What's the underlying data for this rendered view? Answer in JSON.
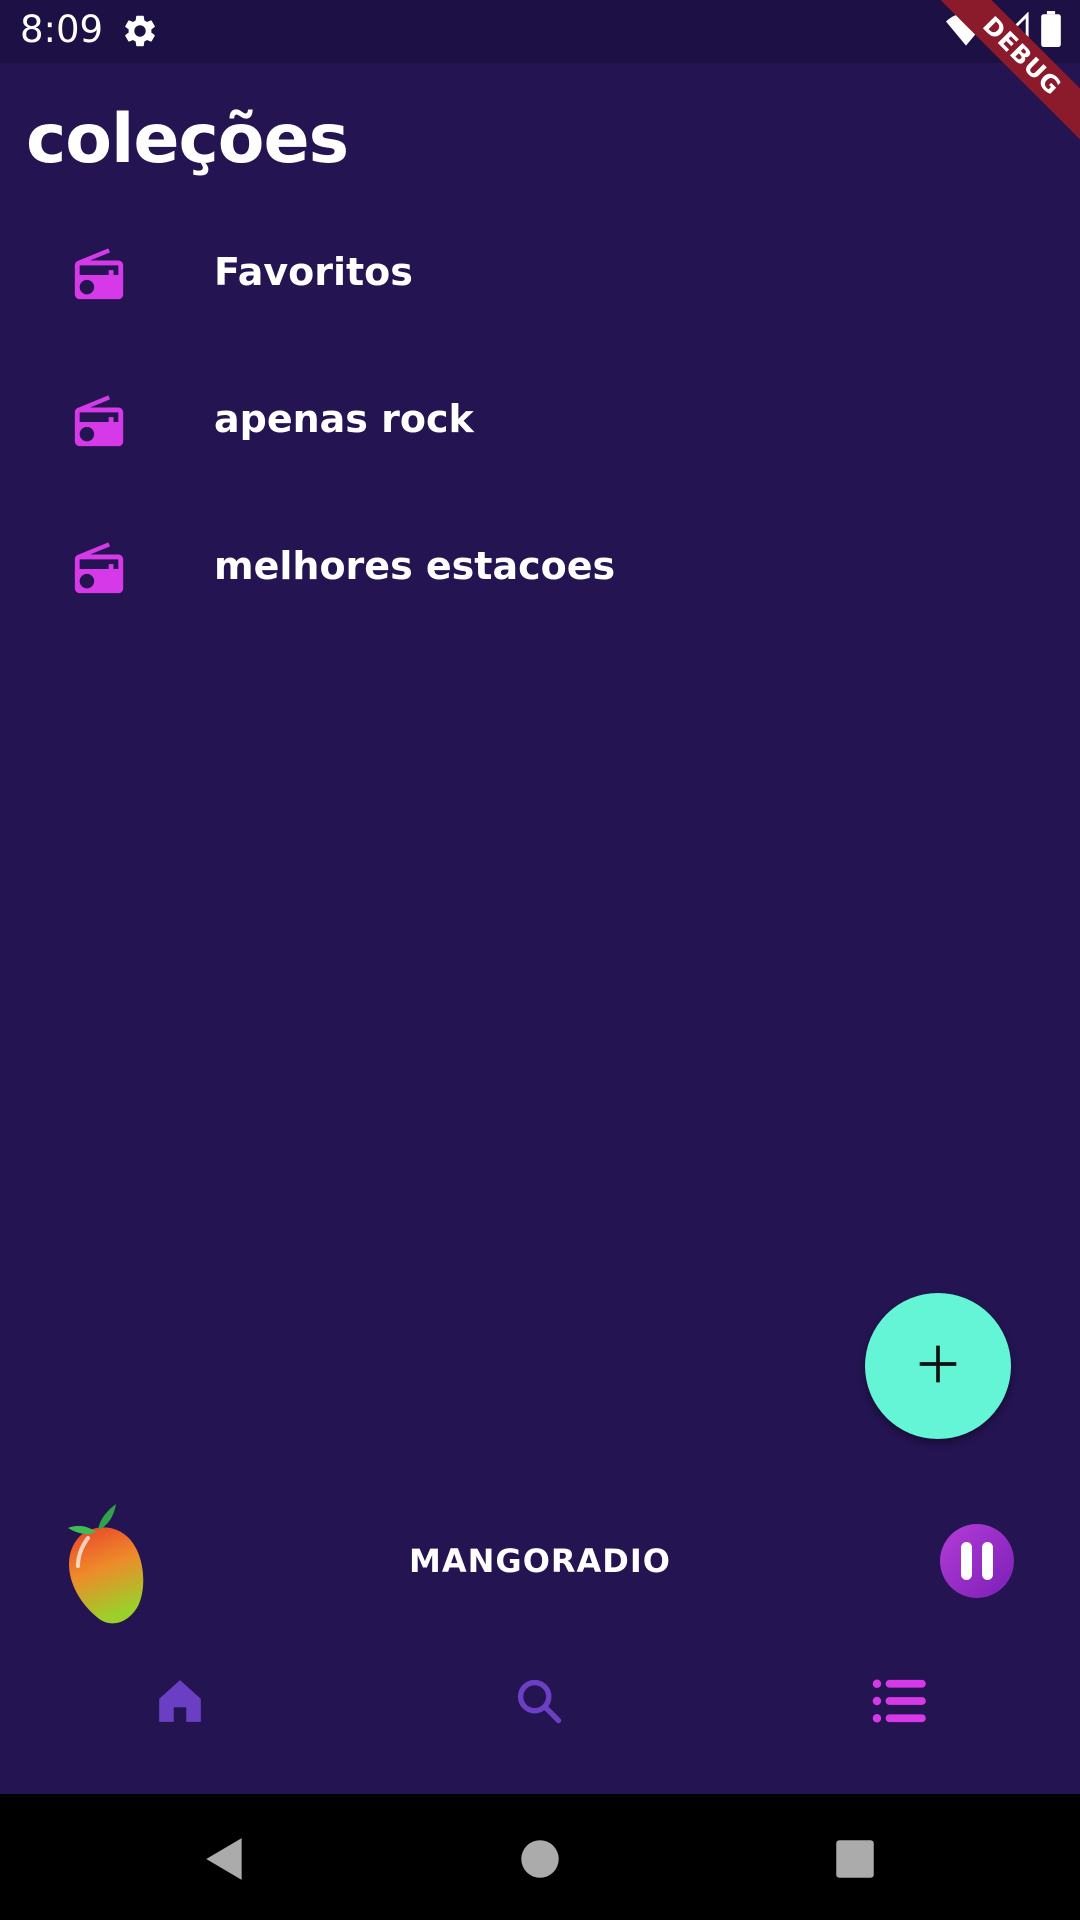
{
  "status_bar": {
    "time": "8:09",
    "debug_label": "DEBUG"
  },
  "page": {
    "title": "coleções"
  },
  "collections": [
    {
      "label": "Favoritos",
      "icon": "radio-icon"
    },
    {
      "label": "apenas rock",
      "icon": "radio-icon"
    },
    {
      "label": "melhores estacoes",
      "icon": "radio-icon"
    }
  ],
  "fab": {
    "icon": "plus-icon"
  },
  "player": {
    "station_name": "MANGORADIO",
    "logo": "mango-logo",
    "state_icon": "pause-icon"
  },
  "bottom_nav": {
    "items": [
      {
        "name": "home",
        "icon": "home-icon"
      },
      {
        "name": "search",
        "icon": "search-icon"
      },
      {
        "name": "collections",
        "icon": "list-icon",
        "active": true
      }
    ]
  },
  "colors": {
    "background": "#241451",
    "status_bar": "#1d1044",
    "accent_magenta": "#d63ae8",
    "nav_purple": "#6b3fc4",
    "fab": "#64f5d7",
    "debug_ribbon": "#8b1a2b"
  }
}
